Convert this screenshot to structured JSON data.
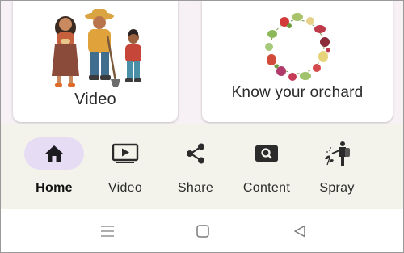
{
  "cards": [
    {
      "label": "Video",
      "illustration": "farmers-family-illustration"
    },
    {
      "label": "Know your orchard",
      "illustration": "fruit-wreath-illustration"
    }
  ],
  "bottom_nav": {
    "active": "Home",
    "items": [
      {
        "label": "Home",
        "icon": "home-icon"
      },
      {
        "label": "Video",
        "icon": "video-player-icon"
      },
      {
        "label": "Share",
        "icon": "share-icon"
      },
      {
        "label": "Content",
        "icon": "image-search-icon"
      },
      {
        "label": "Spray",
        "icon": "sprayer-icon"
      }
    ]
  },
  "system_nav": {
    "buttons": [
      "recent-apps-icon",
      "home-square-icon",
      "back-triangle-icon"
    ]
  },
  "colors": {
    "active_pill": "#e6dcf3",
    "nav_background": "#f3f3ec",
    "content_background": "#f7f1f6"
  }
}
